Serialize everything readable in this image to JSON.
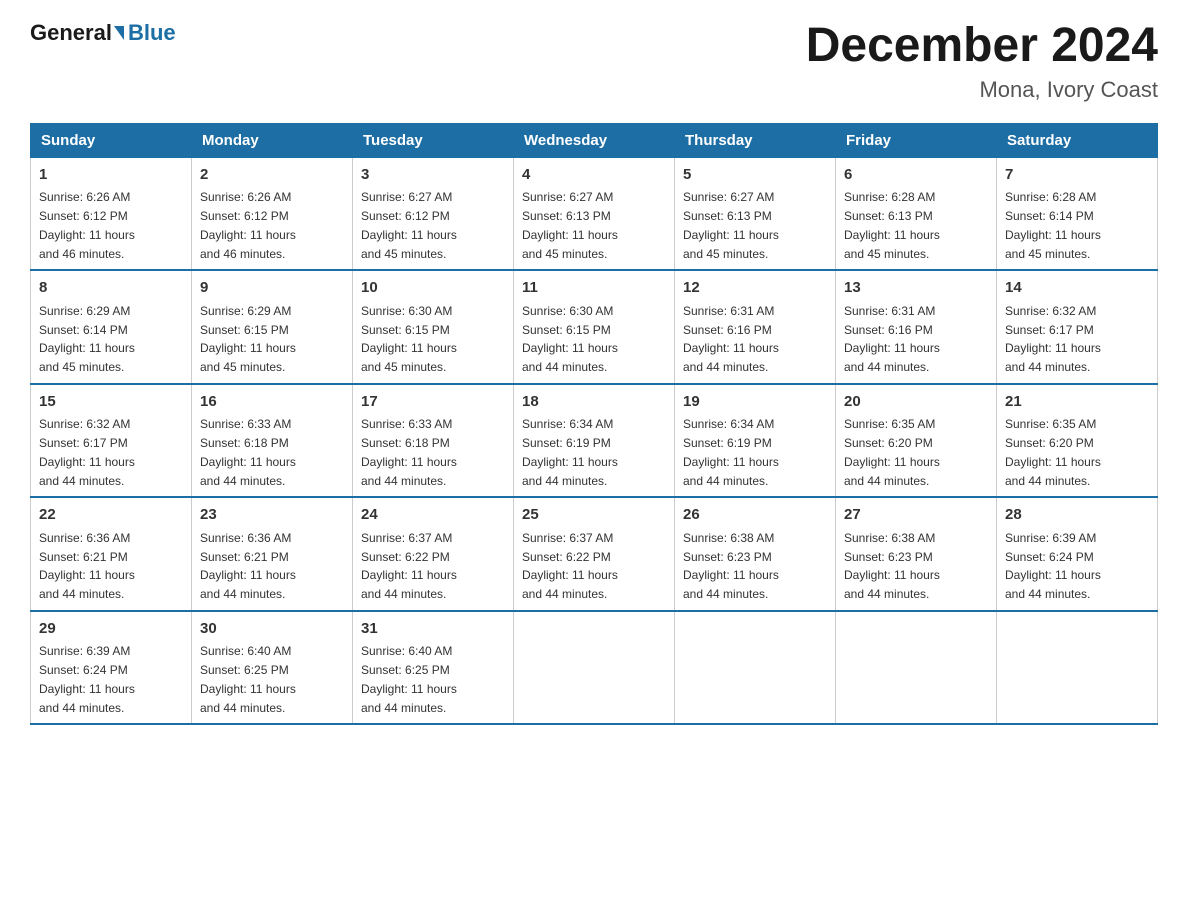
{
  "header": {
    "logo_general": "General",
    "logo_blue": "Blue",
    "title": "December 2024",
    "subtitle": "Mona, Ivory Coast"
  },
  "days_of_week": [
    "Sunday",
    "Monday",
    "Tuesday",
    "Wednesday",
    "Thursday",
    "Friday",
    "Saturday"
  ],
  "weeks": [
    [
      {
        "day": "1",
        "sunrise": "6:26 AM",
        "sunset": "6:12 PM",
        "daylight": "11 hours and 46 minutes."
      },
      {
        "day": "2",
        "sunrise": "6:26 AM",
        "sunset": "6:12 PM",
        "daylight": "11 hours and 46 minutes."
      },
      {
        "day": "3",
        "sunrise": "6:27 AM",
        "sunset": "6:12 PM",
        "daylight": "11 hours and 45 minutes."
      },
      {
        "day": "4",
        "sunrise": "6:27 AM",
        "sunset": "6:13 PM",
        "daylight": "11 hours and 45 minutes."
      },
      {
        "day": "5",
        "sunrise": "6:27 AM",
        "sunset": "6:13 PM",
        "daylight": "11 hours and 45 minutes."
      },
      {
        "day": "6",
        "sunrise": "6:28 AM",
        "sunset": "6:13 PM",
        "daylight": "11 hours and 45 minutes."
      },
      {
        "day": "7",
        "sunrise": "6:28 AM",
        "sunset": "6:14 PM",
        "daylight": "11 hours and 45 minutes."
      }
    ],
    [
      {
        "day": "8",
        "sunrise": "6:29 AM",
        "sunset": "6:14 PM",
        "daylight": "11 hours and 45 minutes."
      },
      {
        "day": "9",
        "sunrise": "6:29 AM",
        "sunset": "6:15 PM",
        "daylight": "11 hours and 45 minutes."
      },
      {
        "day": "10",
        "sunrise": "6:30 AM",
        "sunset": "6:15 PM",
        "daylight": "11 hours and 45 minutes."
      },
      {
        "day": "11",
        "sunrise": "6:30 AM",
        "sunset": "6:15 PM",
        "daylight": "11 hours and 44 minutes."
      },
      {
        "day": "12",
        "sunrise": "6:31 AM",
        "sunset": "6:16 PM",
        "daylight": "11 hours and 44 minutes."
      },
      {
        "day": "13",
        "sunrise": "6:31 AM",
        "sunset": "6:16 PM",
        "daylight": "11 hours and 44 minutes."
      },
      {
        "day": "14",
        "sunrise": "6:32 AM",
        "sunset": "6:17 PM",
        "daylight": "11 hours and 44 minutes."
      }
    ],
    [
      {
        "day": "15",
        "sunrise": "6:32 AM",
        "sunset": "6:17 PM",
        "daylight": "11 hours and 44 minutes."
      },
      {
        "day": "16",
        "sunrise": "6:33 AM",
        "sunset": "6:18 PM",
        "daylight": "11 hours and 44 minutes."
      },
      {
        "day": "17",
        "sunrise": "6:33 AM",
        "sunset": "6:18 PM",
        "daylight": "11 hours and 44 minutes."
      },
      {
        "day": "18",
        "sunrise": "6:34 AM",
        "sunset": "6:19 PM",
        "daylight": "11 hours and 44 minutes."
      },
      {
        "day": "19",
        "sunrise": "6:34 AM",
        "sunset": "6:19 PM",
        "daylight": "11 hours and 44 minutes."
      },
      {
        "day": "20",
        "sunrise": "6:35 AM",
        "sunset": "6:20 PM",
        "daylight": "11 hours and 44 minutes."
      },
      {
        "day": "21",
        "sunrise": "6:35 AM",
        "sunset": "6:20 PM",
        "daylight": "11 hours and 44 minutes."
      }
    ],
    [
      {
        "day": "22",
        "sunrise": "6:36 AM",
        "sunset": "6:21 PM",
        "daylight": "11 hours and 44 minutes."
      },
      {
        "day": "23",
        "sunrise": "6:36 AM",
        "sunset": "6:21 PM",
        "daylight": "11 hours and 44 minutes."
      },
      {
        "day": "24",
        "sunrise": "6:37 AM",
        "sunset": "6:22 PM",
        "daylight": "11 hours and 44 minutes."
      },
      {
        "day": "25",
        "sunrise": "6:37 AM",
        "sunset": "6:22 PM",
        "daylight": "11 hours and 44 minutes."
      },
      {
        "day": "26",
        "sunrise": "6:38 AM",
        "sunset": "6:23 PM",
        "daylight": "11 hours and 44 minutes."
      },
      {
        "day": "27",
        "sunrise": "6:38 AM",
        "sunset": "6:23 PM",
        "daylight": "11 hours and 44 minutes."
      },
      {
        "day": "28",
        "sunrise": "6:39 AM",
        "sunset": "6:24 PM",
        "daylight": "11 hours and 44 minutes."
      }
    ],
    [
      {
        "day": "29",
        "sunrise": "6:39 AM",
        "sunset": "6:24 PM",
        "daylight": "11 hours and 44 minutes."
      },
      {
        "day": "30",
        "sunrise": "6:40 AM",
        "sunset": "6:25 PM",
        "daylight": "11 hours and 44 minutes."
      },
      {
        "day": "31",
        "sunrise": "6:40 AM",
        "sunset": "6:25 PM",
        "daylight": "11 hours and 44 minutes."
      },
      null,
      null,
      null,
      null
    ]
  ],
  "labels": {
    "sunrise": "Sunrise:",
    "sunset": "Sunset:",
    "daylight": "Daylight:"
  }
}
